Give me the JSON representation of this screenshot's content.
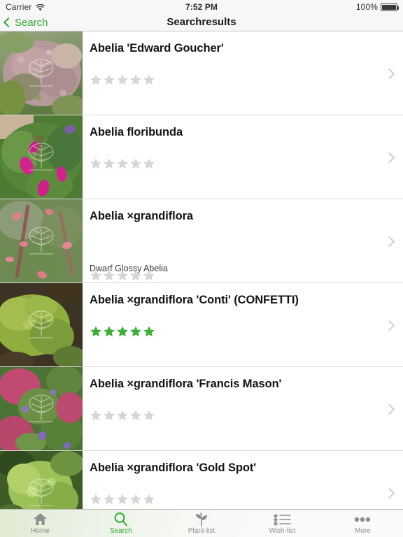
{
  "status_bar": {
    "carrier": "Carrier",
    "wifi_icon": "wifi-icon",
    "time": "7:52 PM",
    "battery_percent": "100%",
    "battery_icon": "battery-icon"
  },
  "nav_bar": {
    "back_label": "Search",
    "back_icon": "chevron-left-icon",
    "title": "Searchresults",
    "accent_color": "#2eab2e"
  },
  "colors": {
    "accent_green": "#2eab2e",
    "star_filled": "#3cb034",
    "star_empty": "#d6d6d6",
    "chevron_gray": "#cfcfcf",
    "tab_inactive": "#8e8e8e",
    "separator": "#d9d9d9"
  },
  "results": [
    {
      "title": "Abelia 'Edward Goucher'",
      "subtitle": "",
      "rating": 0,
      "max_rating": 5,
      "thumbnail_alt": "abelia-edward-goucher-photo",
      "disclosure_icon": "chevron-right-icon"
    },
    {
      "title": "Abelia floribunda",
      "subtitle": "",
      "rating": 0,
      "max_rating": 5,
      "thumbnail_alt": "abelia-floribunda-photo",
      "disclosure_icon": "chevron-right-icon"
    },
    {
      "title": "Abelia ×grandiflora",
      "subtitle": "Dwarf Glossy Abelia",
      "rating": 0,
      "max_rating": 5,
      "thumbnail_alt": "abelia-grandiflora-photo",
      "disclosure_icon": "chevron-right-icon"
    },
    {
      "title": "Abelia ×grandiflora 'Conti' (CONFETTI)",
      "subtitle": "",
      "rating": 5,
      "max_rating": 5,
      "thumbnail_alt": "abelia-grandiflora-conti-confetti-photo",
      "disclosure_icon": "chevron-right-icon"
    },
    {
      "title": "Abelia ×grandiflora 'Francis Mason'",
      "subtitle": "",
      "rating": 0,
      "max_rating": 5,
      "thumbnail_alt": "abelia-grandiflora-francis-mason-photo",
      "disclosure_icon": "chevron-right-icon"
    },
    {
      "title": "Abelia ×grandiflora 'Gold Spot'",
      "subtitle": "",
      "rating": 0,
      "max_rating": 5,
      "thumbnail_alt": "abelia-grandiflora-gold-spot-photo",
      "disclosure_icon": "chevron-right-icon"
    }
  ],
  "tab_bar": {
    "items": [
      {
        "label": "Home",
        "icon": "home-icon",
        "active": false
      },
      {
        "label": "Search",
        "icon": "search-icon",
        "active": true
      },
      {
        "label": "Plant-list",
        "icon": "sprout-icon",
        "active": false
      },
      {
        "label": "Wish-list",
        "icon": "star-list-icon",
        "active": false
      },
      {
        "label": "More",
        "icon": "ellipsis-icon",
        "active": false
      }
    ]
  }
}
